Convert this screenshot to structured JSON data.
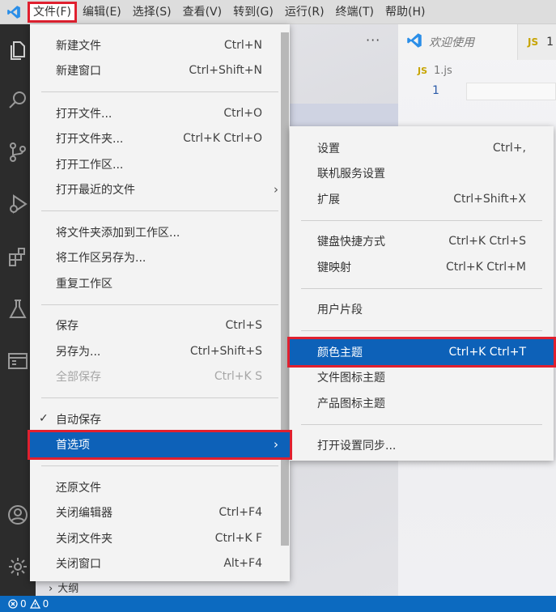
{
  "menubar": {
    "items": [
      {
        "label": "文件(F)",
        "active": true
      },
      {
        "label": "编辑(E)"
      },
      {
        "label": "选择(S)"
      },
      {
        "label": "查看(V)"
      },
      {
        "label": "转到(G)"
      },
      {
        "label": "运行(R)"
      },
      {
        "label": "终端(T)"
      },
      {
        "label": "帮助(H)"
      }
    ]
  },
  "activitybar": {
    "icons": [
      "explorer-icon",
      "search-icon",
      "source-control-icon",
      "run-debug-icon",
      "extensions-icon",
      "testing-icon",
      "remote-explorer-icon",
      "account-icon",
      "manage-gear-icon"
    ]
  },
  "sidebar": {
    "more_actions": "···",
    "outline_label": "大纲"
  },
  "editor": {
    "tabs": [
      {
        "label": "欢迎使用",
        "icon": "vscode-logo-icon"
      },
      {
        "label": "1",
        "icon": "js-file-icon",
        "badge": "JS"
      }
    ],
    "breadcrumb": {
      "badge": "JS",
      "file": "1.js"
    },
    "line_number": "1"
  },
  "statusbar": {
    "errors": "0",
    "warnings": "0"
  },
  "file_menu": {
    "groups": [
      [
        {
          "label": "新建文件",
          "shortcut": "Ctrl+N"
        },
        {
          "label": "新建窗口",
          "shortcut": "Ctrl+Shift+N"
        }
      ],
      [
        {
          "label": "打开文件...",
          "shortcut": "Ctrl+O"
        },
        {
          "label": "打开文件夹...",
          "shortcut": "Ctrl+K Ctrl+O"
        },
        {
          "label": "打开工作区...",
          "shortcut": ""
        },
        {
          "label": "打开最近的文件",
          "shortcut": "",
          "submenu": true
        }
      ],
      [
        {
          "label": "将文件夹添加到工作区...",
          "shortcut": ""
        },
        {
          "label": "将工作区另存为...",
          "shortcut": ""
        },
        {
          "label": "重复工作区",
          "shortcut": ""
        }
      ],
      [
        {
          "label": "保存",
          "shortcut": "Ctrl+S"
        },
        {
          "label": "另存为...",
          "shortcut": "Ctrl+Shift+S"
        },
        {
          "label": "全部保存",
          "shortcut": "Ctrl+K S",
          "disabled": true
        }
      ],
      [
        {
          "label": "自动保存",
          "shortcut": "",
          "checked": true
        },
        {
          "label": "首选项",
          "shortcut": "",
          "submenu": true,
          "selected": true
        }
      ],
      [
        {
          "label": "还原文件",
          "shortcut": ""
        },
        {
          "label": "关闭编辑器",
          "shortcut": "Ctrl+F4"
        },
        {
          "label": "关闭文件夹",
          "shortcut": "Ctrl+K F"
        },
        {
          "label": "关闭窗口",
          "shortcut": "Alt+F4"
        }
      ]
    ]
  },
  "preferences_menu": {
    "groups": [
      [
        {
          "label": "设置",
          "shortcut": "Ctrl+,"
        },
        {
          "label": "联机服务设置",
          "shortcut": ""
        },
        {
          "label": "扩展",
          "shortcut": "Ctrl+Shift+X"
        }
      ],
      [
        {
          "label": "键盘快捷方式",
          "shortcut": "Ctrl+K Ctrl+S"
        },
        {
          "label": "键映射",
          "shortcut": "Ctrl+K Ctrl+M"
        }
      ],
      [
        {
          "label": "用户片段",
          "shortcut": ""
        }
      ],
      [
        {
          "label": "颜色主题",
          "shortcut": "Ctrl+K Ctrl+T",
          "selected": true
        },
        {
          "label": "文件图标主题",
          "shortcut": ""
        },
        {
          "label": "产品图标主题",
          "shortcut": ""
        }
      ],
      [
        {
          "label": "打开设置同步...",
          "shortcut": ""
        }
      ]
    ]
  },
  "colors": {
    "highlight_outline": "#e0202f",
    "selection": "#0d61b8",
    "statusbar": "#0c6ac0",
    "activitybar": "#2c2c2c",
    "vscode_blue": "#2a8ee8"
  }
}
